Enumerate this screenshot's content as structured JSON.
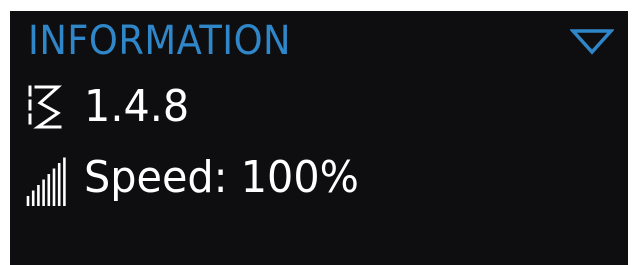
{
  "panel": {
    "title": "INFORMATION",
    "collapse_icon": "triangle-down-icon"
  },
  "info": {
    "version_icon": "version-icon",
    "version": "1.4.8",
    "speed_icon": "signal-bars-icon",
    "speed_text": "Speed: 100%",
    "speed_percent": 100
  },
  "colors": {
    "accent": "#2f86c8",
    "background": "#0e0e10",
    "text": "#ffffff"
  }
}
